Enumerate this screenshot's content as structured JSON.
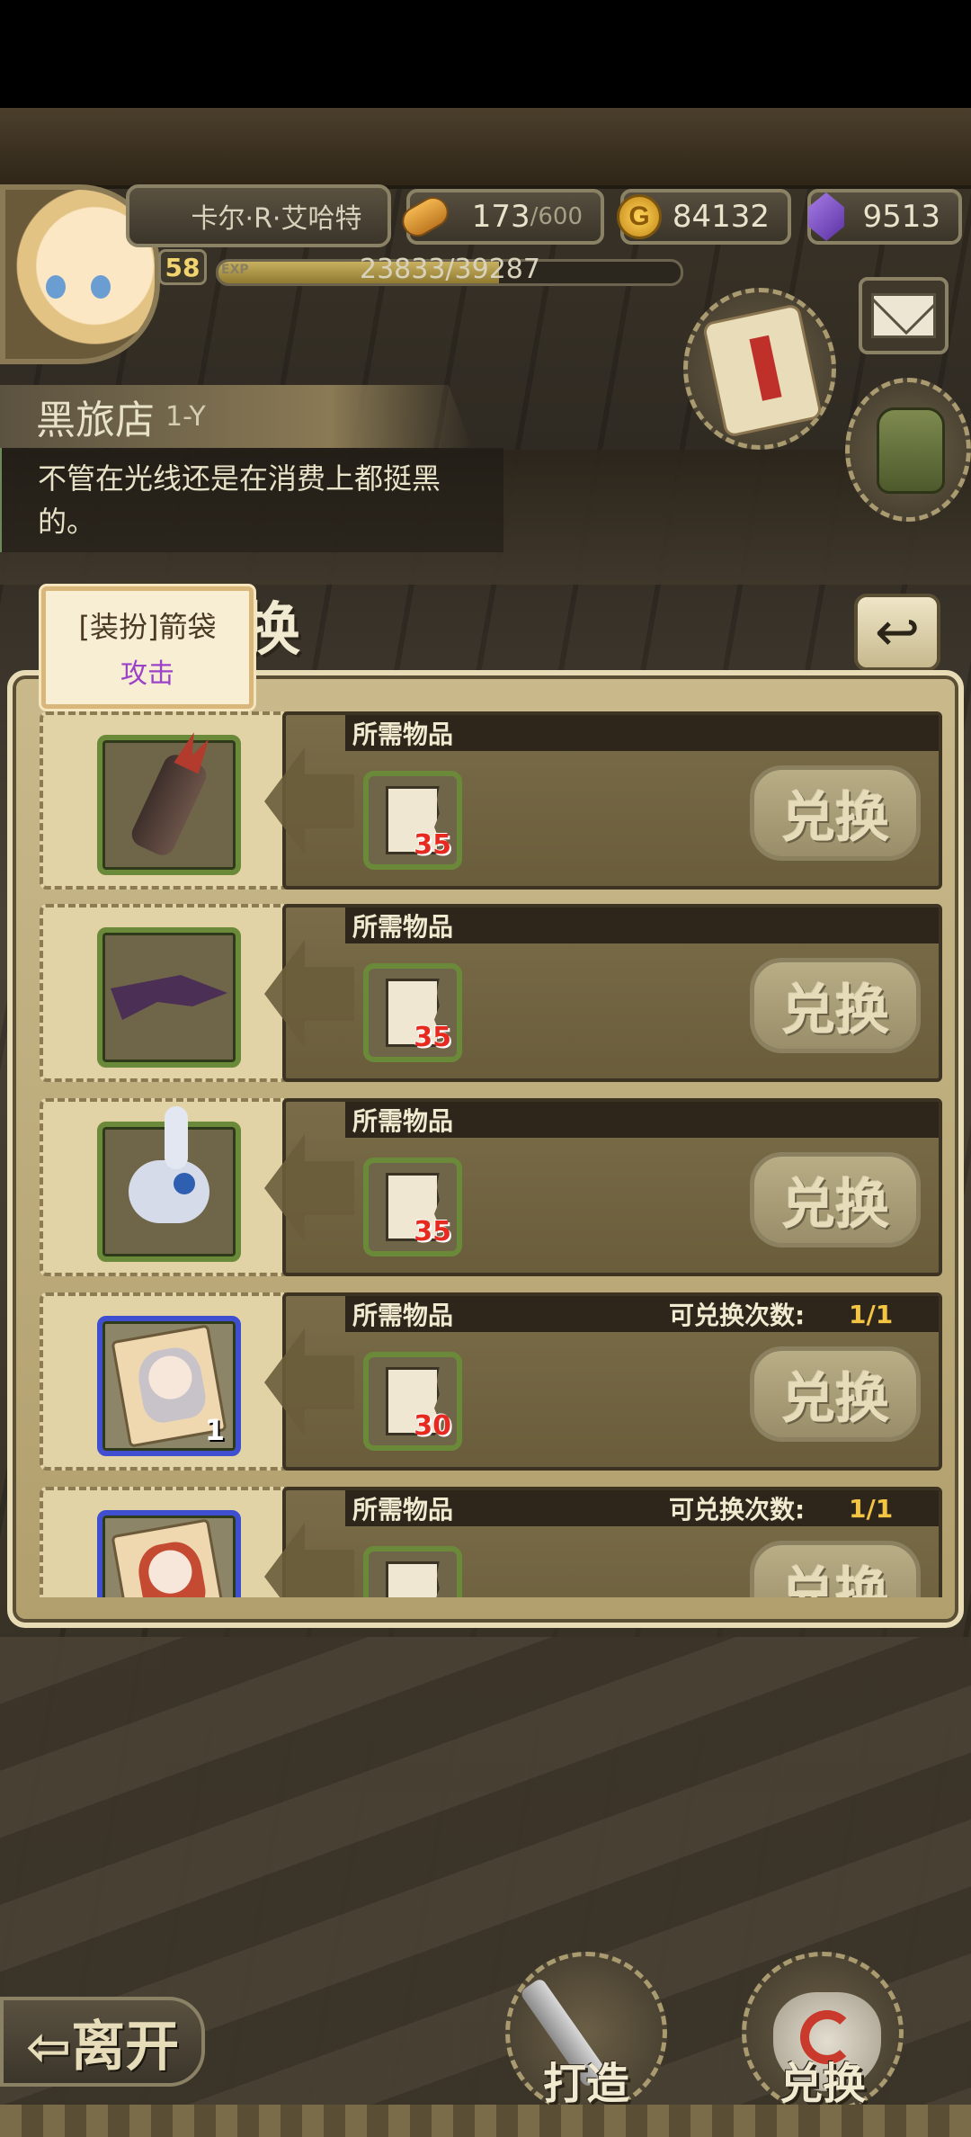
{
  "player": {
    "name": "卡尔·R·艾哈特",
    "level": "58",
    "exp_tag": "EXP",
    "exp_text": "23833/39287",
    "exp_ratio": 0.607
  },
  "resources": {
    "stamina_current": "173",
    "stamina_max": "/600",
    "gold": "84132",
    "gems": "9513"
  },
  "location": {
    "name": "黑旅店",
    "code": "1-Y",
    "description": "不管在光线还是在消费上都挺黑的。"
  },
  "panel": {
    "title": "换",
    "back_icon": "↩"
  },
  "tooltip": {
    "name": "[装扮]箭袋",
    "attribute": "攻击"
  },
  "exchange_rows": [
    {
      "reward_icon": "quiver-icon",
      "required_label": "所需物品",
      "required_count": "35",
      "button": "兑换",
      "limit_label": "",
      "limit_value": "",
      "reward_count": ""
    },
    {
      "reward_icon": "scarf-icon",
      "required_label": "所需物品",
      "required_count": "35",
      "button": "兑换",
      "limit_label": "",
      "limit_value": "",
      "reward_count": ""
    },
    {
      "reward_icon": "bunny-doll-icon",
      "required_label": "所需物品",
      "required_count": "35",
      "button": "兑换",
      "limit_label": "",
      "limit_value": "",
      "reward_count": ""
    },
    {
      "reward_icon": "character-card-icon",
      "required_label": "所需物品",
      "required_count": "30",
      "button": "兑换",
      "limit_label": "可兑换次数:",
      "limit_value": "1/1",
      "reward_count": "1"
    },
    {
      "reward_icon": "character-card-icon",
      "required_label": "所需物品",
      "required_count": "",
      "button": "兑换",
      "limit_label": "可兑换次数:",
      "limit_value": "1/1",
      "reward_count": ""
    }
  ],
  "bottom_nav": {
    "leave": "⇦离开",
    "craft": "打造",
    "exchange": "兑换"
  },
  "colors": {
    "panel_bg": "#c9b98b",
    "row_bg": "#7a6c48",
    "limit_value": "#f4c542",
    "required_count": "#e62a1f",
    "tooltip_attribute": "#9b43c8"
  }
}
